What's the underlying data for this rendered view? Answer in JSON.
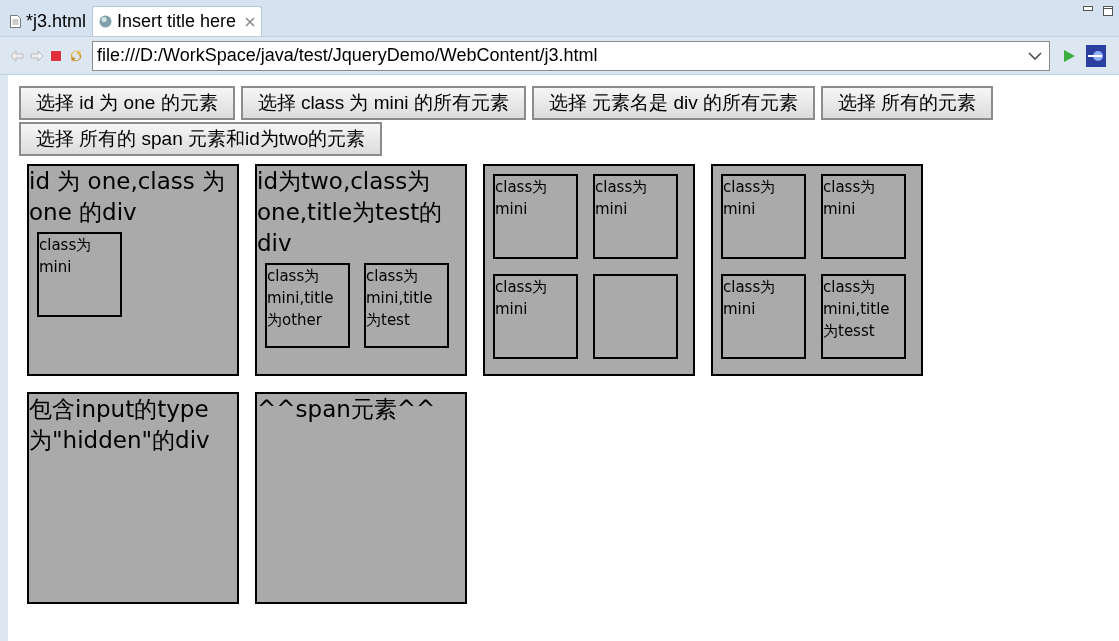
{
  "tabs": [
    {
      "label": "*j3.html",
      "selected": false,
      "kind": "file"
    },
    {
      "label": "Insert title here",
      "selected": true,
      "kind": "browser",
      "closable": true
    }
  ],
  "address_bar": {
    "value": "file:///D:/WorkSpace/java/test/JqueryDemo/WebContent/j3.html"
  },
  "buttons": [
    "选择 id 为 one 的元素",
    "选择 class 为 mini 的所有元素",
    "选择 元素名是 div 的所有元素",
    "选择 所有的元素",
    "选择 所有的 span 元素和id为two的元素"
  ],
  "boxes": [
    {
      "kind": "nested",
      "title": "id 为 one,class 为 one 的div",
      "minis": [
        {
          "text": "class为mini"
        }
      ]
    },
    {
      "kind": "nested",
      "title": "id为two,class为one,title为test的div",
      "minis": [
        {
          "text": "class为mini,title为other"
        },
        {
          "text": "class为mini,title为test"
        }
      ]
    },
    {
      "kind": "grid",
      "minis": [
        {
          "text": "class为mini"
        },
        {
          "text": "class为mini"
        },
        {
          "text": "class为mini"
        }
      ],
      "blank_slot": true
    },
    {
      "kind": "grid",
      "minis": [
        {
          "text": "class为mini"
        },
        {
          "text": "class为mini"
        },
        {
          "text": "class为mini"
        },
        {
          "text": "class为mini,title为tesst"
        }
      ]
    },
    {
      "kind": "plain",
      "title": "包含input的type为\"hidden\"的div"
    },
    {
      "kind": "plain",
      "title": "^^span元素^^"
    }
  ]
}
